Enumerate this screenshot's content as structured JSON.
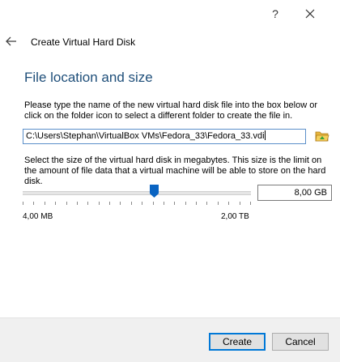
{
  "titlebar": {
    "help_label": "?"
  },
  "wizard": {
    "title": "Create Virtual Hard Disk"
  },
  "section": {
    "heading": "File location and size",
    "location_description": "Please type the name of the new virtual hard disk file into the box below or click on the folder icon to select a different folder to create the file in.",
    "path_value": "C:\\Users\\Stephan\\VirtualBox VMs\\Fedora_33\\Fedora_33.vdi",
    "size_description": "Select the size of the virtual hard disk in megabytes. This size is the limit on the amount of file data that a virtual machine will be able to store on the hard disk.",
    "size_min_label": "4,00 MB",
    "size_max_label": "2,00 TB",
    "size_value": "8,00 GB",
    "slider_fraction": 0.58
  },
  "footer": {
    "create_label": "Create",
    "cancel_label": "Cancel"
  },
  "icons": {
    "back": "arrow-left-icon",
    "close": "close-icon",
    "folder": "folder-open-icon"
  },
  "colors": {
    "accent": "#0078d7",
    "heading": "#1f4f7a",
    "slider_handle": "#0a64c2"
  }
}
